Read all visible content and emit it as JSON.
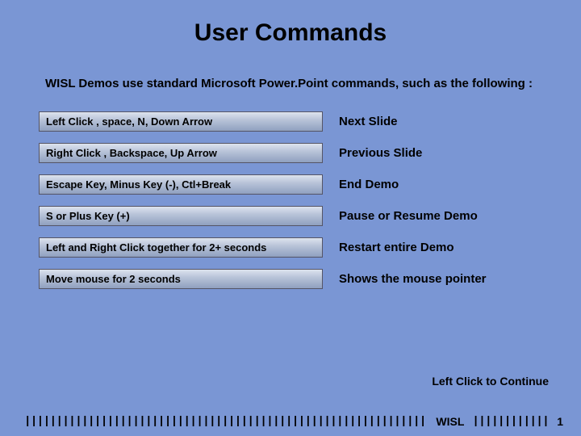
{
  "title": "User Commands",
  "intro": "WISL Demos use standard Microsoft Power.Point commands, such as the following :",
  "rows": [
    {
      "command": "Left Click , space, N,  Down Arrow",
      "action": "Next Slide"
    },
    {
      "command": "Right Click , Backspace, Up Arrow",
      "action": "Previous Slide"
    },
    {
      "command": "Escape Key, Minus Key (-), Ctl+Break",
      "action": "End Demo"
    },
    {
      "command": "S or Plus Key (+)",
      "action": "Pause or Resume Demo"
    },
    {
      "command": "Left and Right Click together for 2+ seconds",
      "action": "Restart entire Demo"
    },
    {
      "command": "Move mouse for 2 seconds",
      "action": "Shows the mouse pointer"
    }
  ],
  "continue_label": "Left Click to Continue",
  "footer": {
    "ticks_left": "||||||||||||||||||||||||||||||||||||||||||||||||||||||||||||||||||||||||||||||||||||||||||||||||||||||||||||||",
    "brand": "WISL",
    "ticks_right": "||||||||||||",
    "page": "1"
  }
}
